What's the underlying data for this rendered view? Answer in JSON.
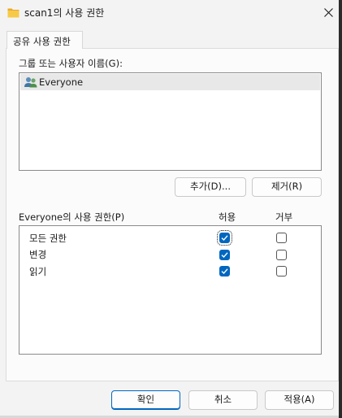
{
  "window": {
    "title": "scan1의 사용 권한",
    "icon": "folder-icon",
    "colors": {
      "accent": "#0067c0",
      "folder": "#f5c242"
    }
  },
  "tabs": [
    {
      "label": "공유 사용 권한",
      "selected": true
    }
  ],
  "groups": {
    "label": "그룹 또는 사용자 이름(G):",
    "items": [
      {
        "name": "Everyone",
        "icon": "users-icon",
        "selected": true
      }
    ],
    "add_button": "추가(D)...",
    "remove_button": "제거(R)"
  },
  "permissions": {
    "label": "Everyone의 사용 권한(P)",
    "allow_header": "허용",
    "deny_header": "거부",
    "rows": [
      {
        "name": "모든 권한",
        "allow": true,
        "deny": false
      },
      {
        "name": "변경",
        "allow": true,
        "deny": false
      },
      {
        "name": "읽기",
        "allow": true,
        "deny": false
      }
    ]
  },
  "footer": {
    "ok": "확인",
    "cancel": "취소",
    "apply": "적용(A)"
  }
}
